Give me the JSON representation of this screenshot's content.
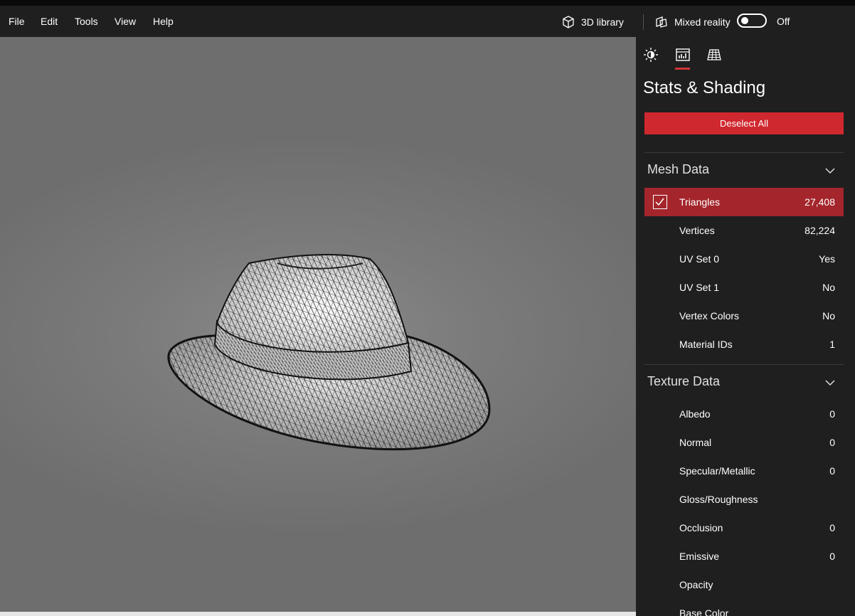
{
  "menu": {
    "file": "File",
    "edit": "Edit",
    "tools": "Tools",
    "view": "View",
    "help": "Help"
  },
  "topbar": {
    "library_label": "3D library",
    "library_icon": "cube-icon",
    "mixed_reality_label": "Mixed reality",
    "mixed_reality_icon": "mixed-reality-icon",
    "toggle_state": "Off"
  },
  "panel": {
    "tabs": [
      {
        "name": "lighting",
        "icon": "sun-icon"
      },
      {
        "name": "stats",
        "icon": "stats-chart-icon",
        "selected": true
      },
      {
        "name": "grid",
        "icon": "grid-icon"
      }
    ],
    "title": "Stats & Shading",
    "deselect_label": "Deselect All",
    "accent": "#d0282f",
    "mesh": {
      "title": "Mesh Data",
      "rows": [
        {
          "label": "Triangles",
          "value": "27,408",
          "checked": true
        },
        {
          "label": "Vertices",
          "value": "82,224"
        },
        {
          "label": "UV Set 0",
          "value": "Yes"
        },
        {
          "label": "UV Set 1",
          "value": "No"
        },
        {
          "label": "Vertex Colors",
          "value": "No"
        },
        {
          "label": "Material IDs",
          "value": "1"
        }
      ]
    },
    "texture": {
      "title": "Texture Data",
      "rows": [
        {
          "label": "Albedo",
          "value": "0"
        },
        {
          "label": "Normal",
          "value": "0"
        },
        {
          "label": "Specular/Metallic",
          "value": "0"
        },
        {
          "label": "Gloss/Roughness",
          "value": ""
        },
        {
          "label": "Occlusion",
          "value": "0"
        },
        {
          "label": "Emissive",
          "value": "0"
        },
        {
          "label": "Opacity",
          "value": ""
        },
        {
          "label": "Base Color",
          "value": ""
        }
      ]
    }
  }
}
